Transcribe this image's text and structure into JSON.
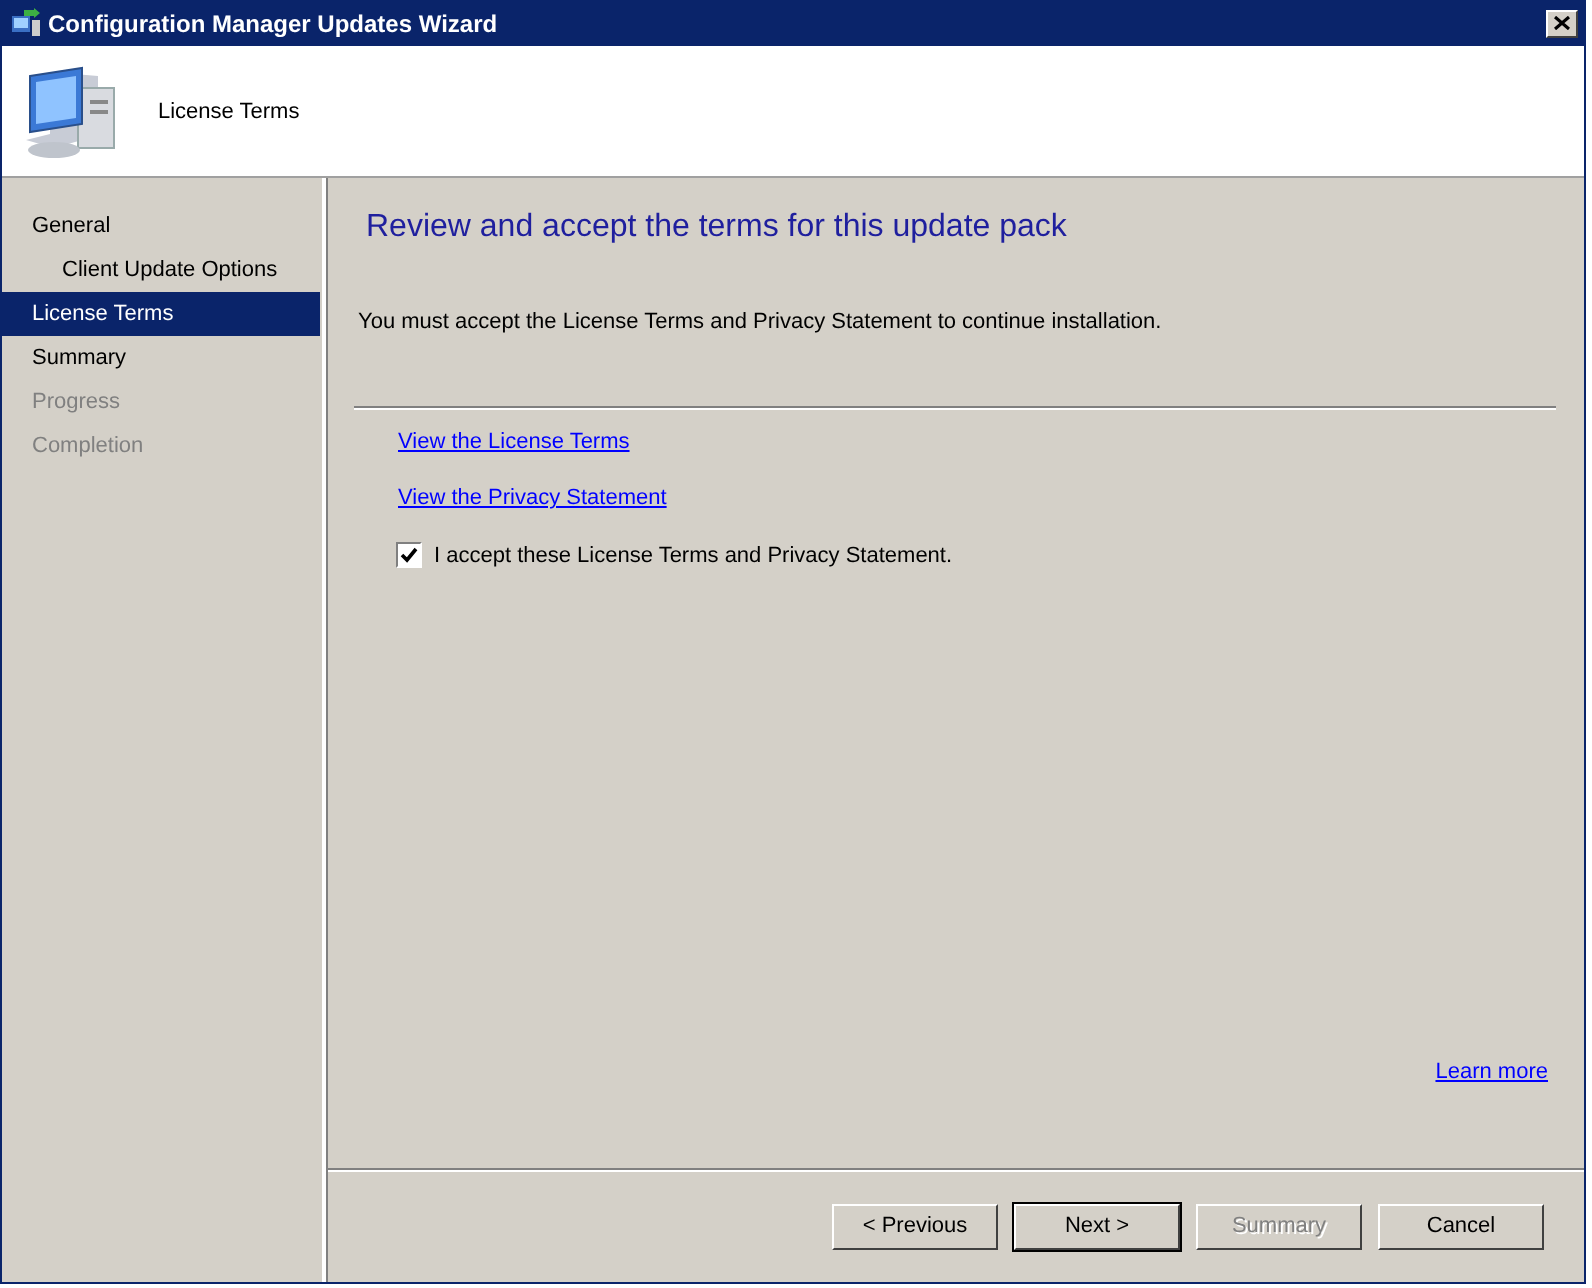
{
  "window": {
    "title": "Configuration Manager Updates Wizard"
  },
  "header": {
    "title": "License Terms"
  },
  "nav": [
    {
      "label": "General",
      "selected": false,
      "disabled": false,
      "children": [
        {
          "label": "Client Update Options",
          "selected": false,
          "disabled": false
        }
      ]
    },
    {
      "label": "License Terms",
      "selected": true,
      "disabled": false
    },
    {
      "label": "Summary",
      "selected": false,
      "disabled": false
    },
    {
      "label": "Progress",
      "selected": false,
      "disabled": true
    },
    {
      "label": "Completion",
      "selected": false,
      "disabled": true
    }
  ],
  "page": {
    "heading": "Review and accept the terms for this update pack",
    "instruction": "You must accept the License Terms and Privacy Statement to continue installation.",
    "links": [
      "View the License Terms",
      "View the Privacy Statement"
    ],
    "accept": {
      "label": "I accept these License Terms and Privacy Statement.",
      "checked": true
    },
    "learn_more": "Learn more"
  },
  "buttons": [
    {
      "label": "< Previous",
      "disabled": false,
      "default": false
    },
    {
      "label": "Next >",
      "disabled": false,
      "default": true
    },
    {
      "label": "Summary",
      "disabled": true,
      "default": false
    },
    {
      "label": "Cancel",
      "disabled": false,
      "default": false
    }
  ]
}
